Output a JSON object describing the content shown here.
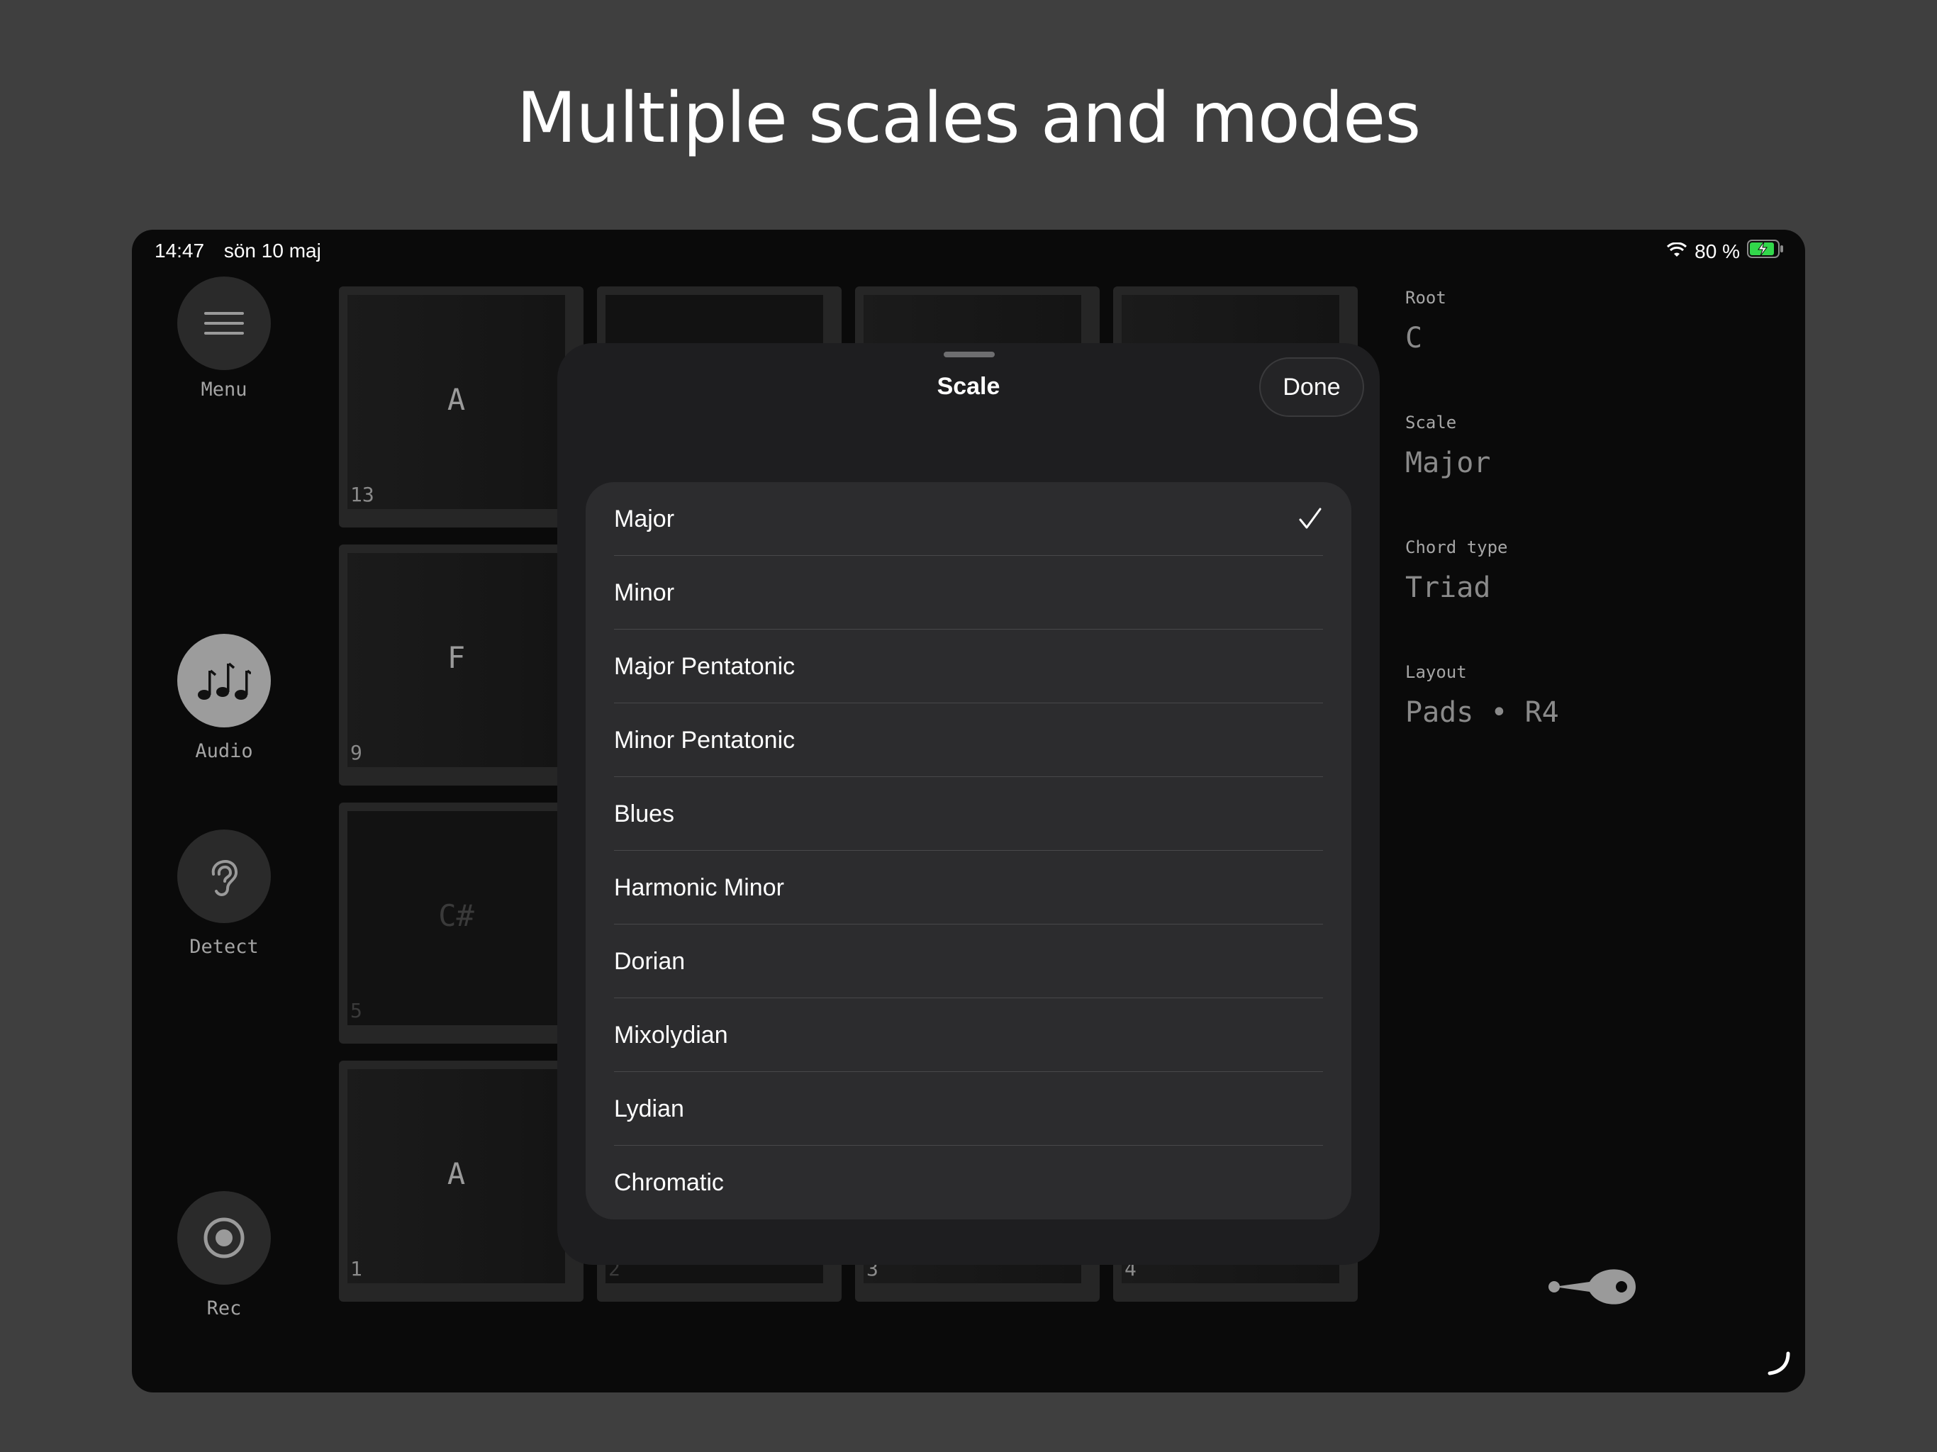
{
  "headline": "Multiple scales and modes",
  "status": {
    "time": "14:47",
    "date": "sön 10 maj",
    "battery": "80 %"
  },
  "rail": {
    "menu": "Menu",
    "audio": "Audio",
    "detect": "Detect",
    "rec": "Rec"
  },
  "pads": [
    {
      "note": "A",
      "num": "13"
    },
    {
      "note": "F",
      "num": "9"
    },
    {
      "note": "C#",
      "num": "5"
    },
    {
      "note": "A",
      "num": "1"
    },
    {
      "num": "2"
    },
    {
      "num": "3"
    },
    {
      "num": "4"
    }
  ],
  "info": {
    "root_label": "Root",
    "root_value": "C",
    "scale_label": "Scale",
    "scale_value": "Major",
    "chord_label": "Chord type",
    "chord_value": "Triad",
    "layout_label": "Layout",
    "layout_value": "Pads • R4"
  },
  "sheet": {
    "title": "Scale",
    "done": "Done",
    "selected": "Major",
    "options": [
      "Major",
      "Minor",
      "Major Pentatonic",
      "Minor Pentatonic",
      "Blues",
      "Harmonic Minor",
      "Dorian",
      "Mixolydian",
      "Lydian",
      "Chromatic"
    ]
  }
}
